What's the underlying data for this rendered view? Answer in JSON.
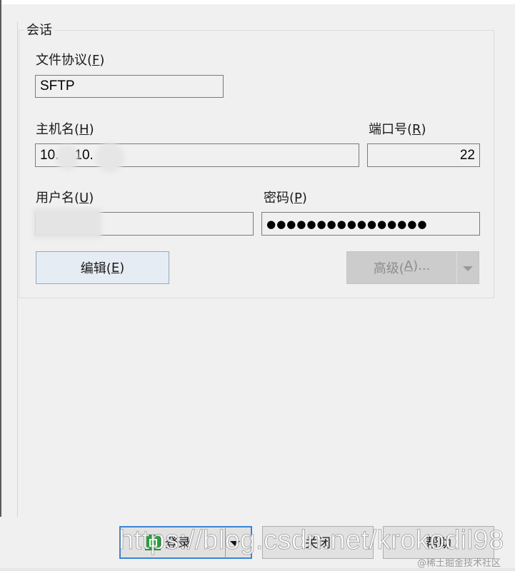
{
  "session": {
    "group_title": "会话",
    "protocol_label": "文件协议(",
    "protocol_key": "F",
    "protocol_label_end": ")",
    "protocol_value": "SFTP",
    "host_label": "主机名(",
    "host_key": "H",
    "host_label_end": ")",
    "host_value_part1": "10.",
    "host_value_part2": "10.",
    "port_label": "端口号(",
    "port_key": "R",
    "port_label_end": ")",
    "port_value": "22",
    "user_label": "用户名(",
    "user_key": "U",
    "user_label_end": ")",
    "password_label": "密码(",
    "password_key": "P",
    "password_label_end": ")",
    "password_mask": "●●●●●●●●●●●●●●●●",
    "edit_label": "编辑(",
    "edit_key": "E",
    "edit_label_end": ")",
    "advanced_label": "高级(",
    "advanced_key": "A",
    "advanced_label_end": ")..."
  },
  "footer": {
    "login_label": "登录",
    "close_label": "关闭",
    "help_label": "帮助"
  },
  "watermark": {
    "url": "https://blog.csdn.net/krokodil98",
    "brand": "@稀土掘金技术社区"
  }
}
